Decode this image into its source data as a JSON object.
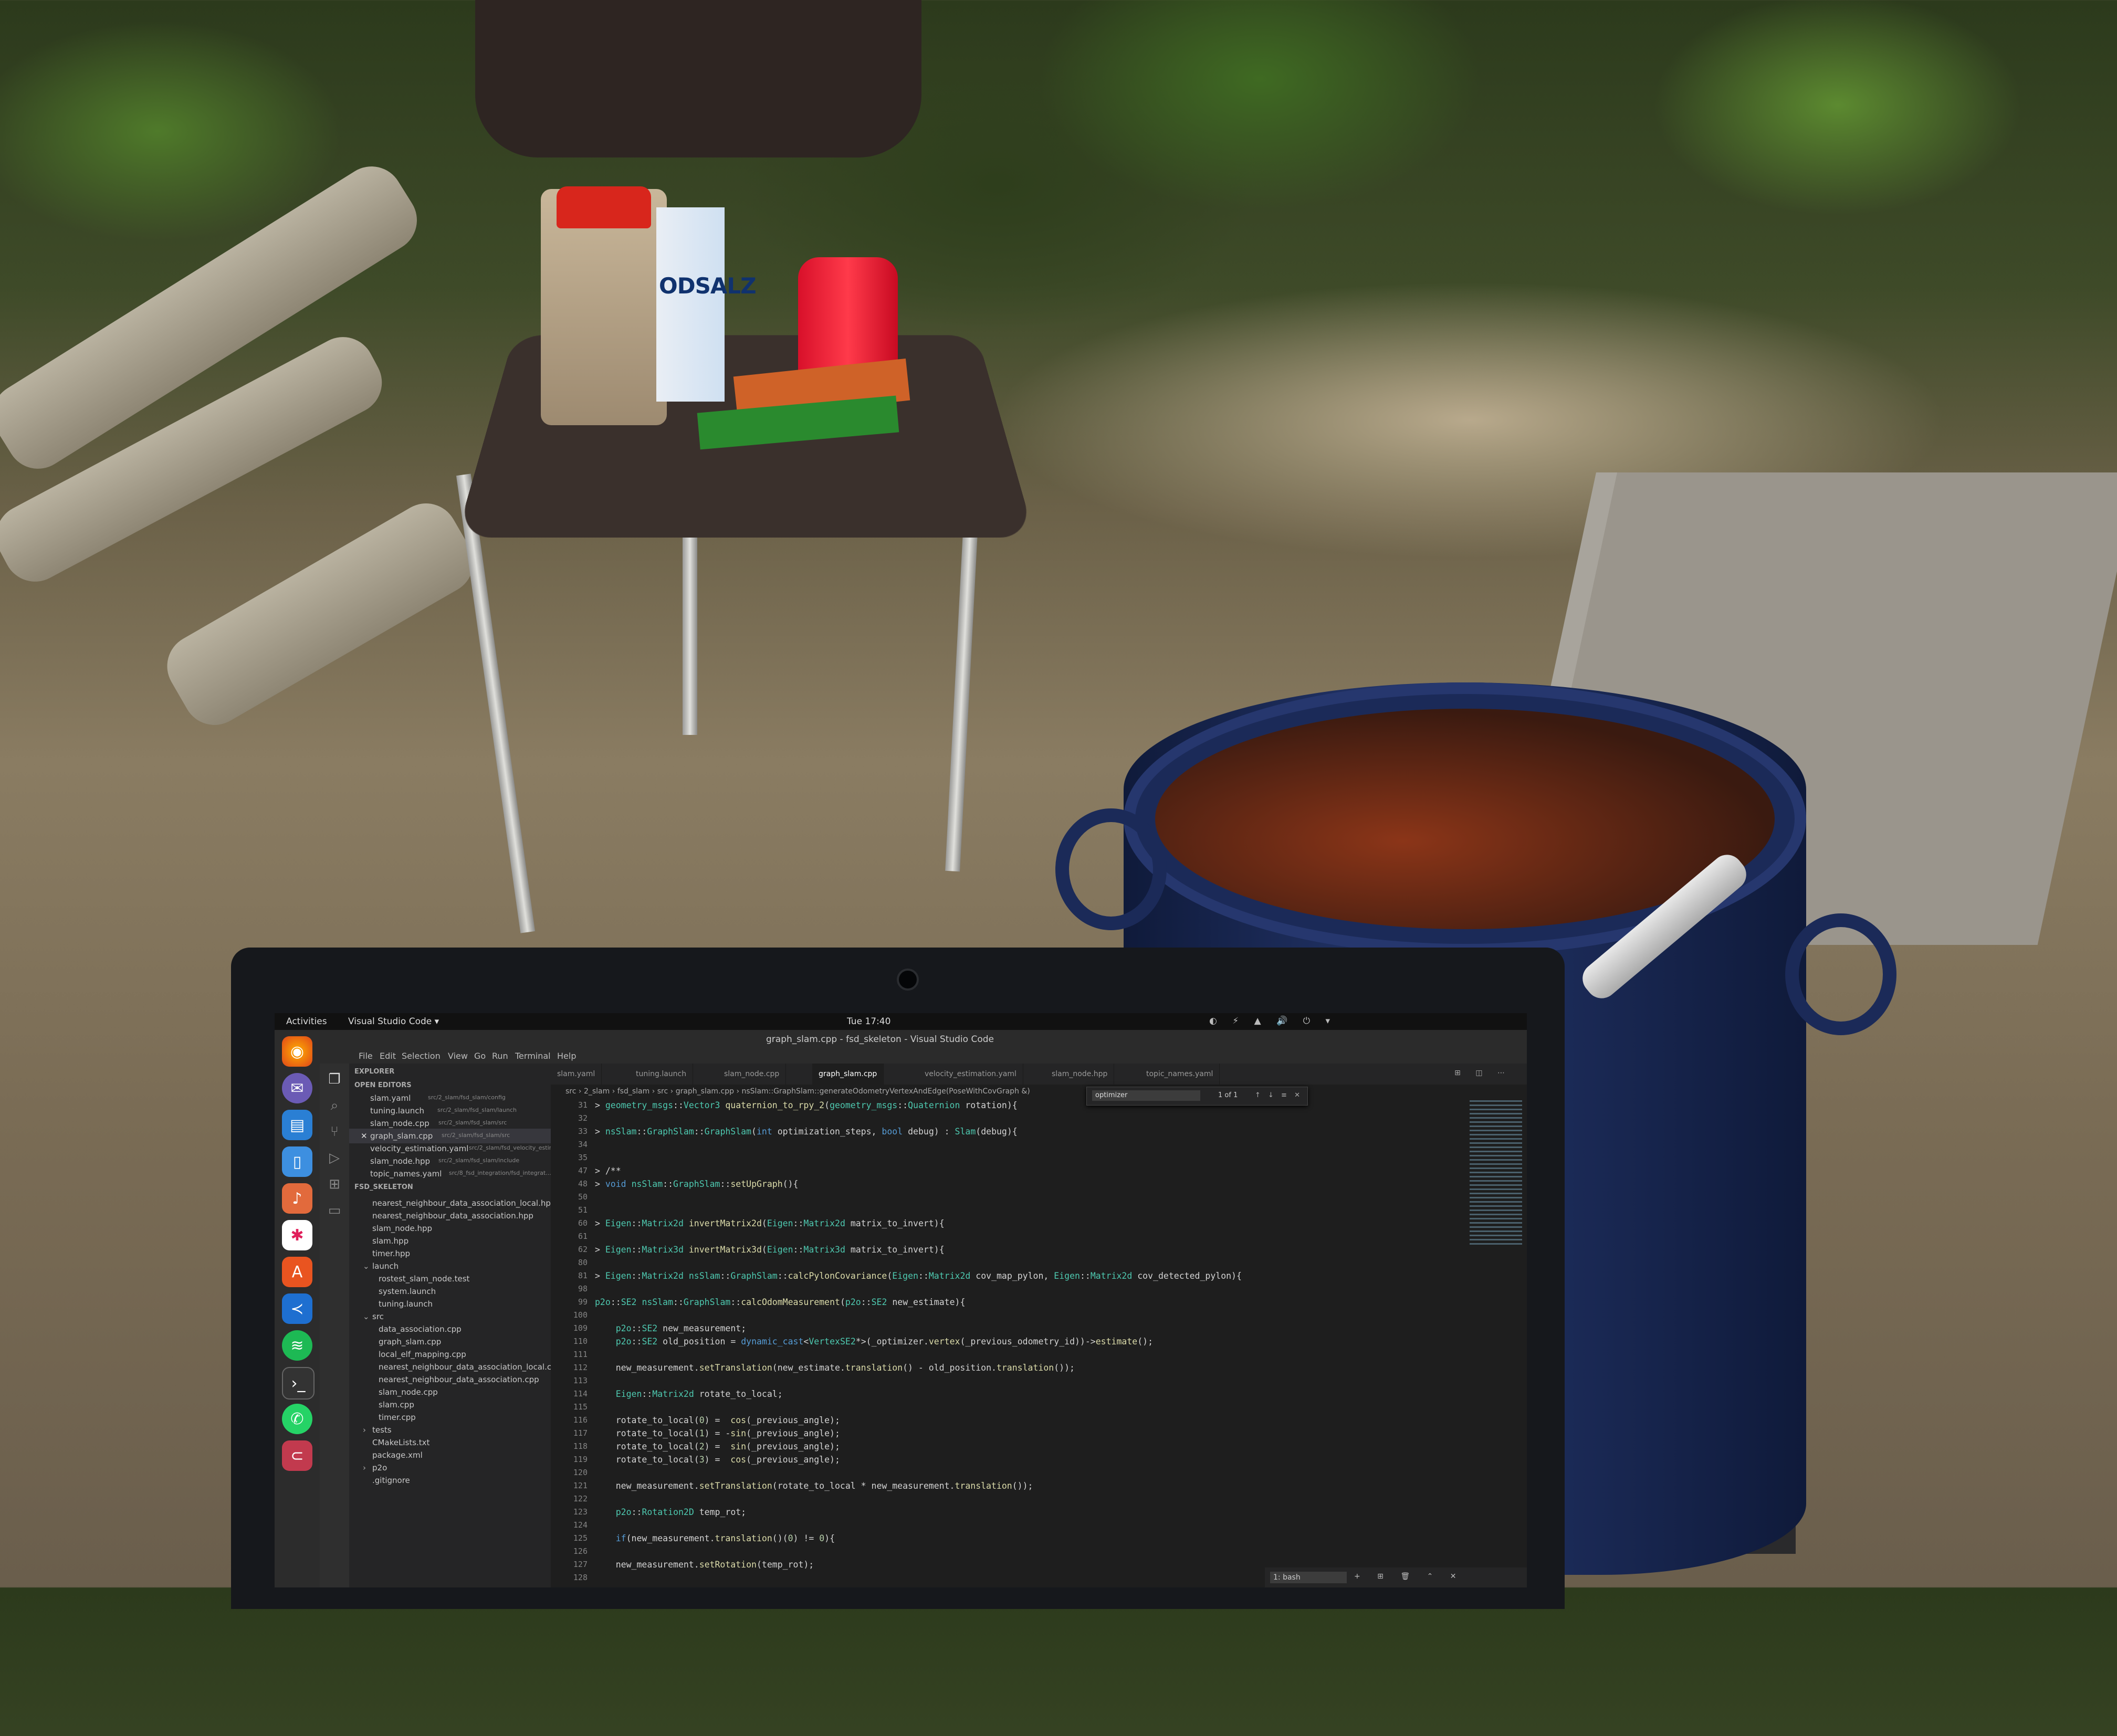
{
  "scene": {
    "salt_box_text": "ODSALZ"
  },
  "topbar": {
    "activities": "Activities",
    "app_menu": "Visual Studio Code ▾",
    "clock": "Tue 17:40",
    "tray_icons": "◐ ⚡ ▲ 🔊 ⏻ ▾"
  },
  "dock": {
    "icons": [
      "firefox-icon",
      "thunderbird-icon",
      "files-icon",
      "libreoffice-icon",
      "rhythmbox-icon",
      "slack-icon",
      "software-icon",
      "vscode-icon",
      "spotify-icon",
      "terminal-icon",
      "whatsapp-icon",
      "gitk-icon"
    ]
  },
  "vscode": {
    "window_title": "graph_slam.cpp - fsd_skeleton - Visual Studio Code",
    "menu": [
      "File",
      "Edit",
      "Selection",
      "View",
      "Go",
      "Run",
      "Terminal",
      "Help"
    ],
    "sidebar": {
      "explorer_label": "EXPLORER",
      "open_editors_label": "OPEN EDITORS",
      "open_editors": [
        {
          "name": "slam.yaml",
          "path": "src/2_slam/fsd_slam/config"
        },
        {
          "name": "tuning.launch",
          "path": "src/2_slam/fsd_slam/launch"
        },
        {
          "name": "slam_node.cpp",
          "path": "src/2_slam/fsd_slam/src"
        },
        {
          "name": "graph_slam.cpp",
          "path": "src/2_slam/fsd_slam/src"
        },
        {
          "name": "velocity_estimation.yaml",
          "path": "src/2_slam/fsd_velocity_estimati..."
        },
        {
          "name": "slam_node.hpp",
          "path": "src/2_slam/fsd_slam/include"
        },
        {
          "name": "topic_names.yaml",
          "path": "src/8_fsd_integration/fsd_integrat..."
        }
      ],
      "project_label": "FSD_SKELETON",
      "tree": [
        "nearest_neighbour_data_association_local.hpp",
        "nearest_neighbour_data_association.hpp",
        "slam_node.hpp",
        "slam.hpp",
        "timer.hpp",
        "launch",
        "rostest_slam_node.test",
        "system.launch",
        "tuning.launch",
        "src",
        "data_association.cpp",
        "graph_slam.cpp",
        "local_elf_mapping.cpp",
        "nearest_neighbour_data_association_local.cpp",
        "nearest_neighbour_data_association.cpp",
        "slam_node.cpp",
        "slam.cpp",
        "timer.cpp",
        "tests",
        "CMakeLists.txt",
        "package.xml",
        "p2o",
        ".gitignore"
      ]
    },
    "tabs": [
      "slam.yaml",
      "tuning.launch",
      "slam_node.cpp",
      "graph_slam.cpp",
      "velocity_estimation.yaml",
      "slam_node.hpp",
      "topic_names.yaml"
    ],
    "active_tab": "graph_slam.cpp",
    "breadcrumb": "src › 2_slam › fsd_slam › src › graph_slam.cpp › nsSlam::GraphSlam::generateOdometryVertexAndEdge(PoseWithCovGraph &)",
    "find": {
      "query": "optimizer",
      "count": "1 of 1",
      "options": "↑ ↓ ≡ ✕"
    },
    "line_numbers": [
      "31",
      "32",
      "33",
      "34",
      "35",
      "47",
      "48",
      "50",
      "51",
      "60",
      "61",
      "62",
      "80",
      "81",
      "98",
      "99",
      "100",
      "109",
      "110",
      "111",
      "112",
      "113",
      "114",
      "115",
      "116",
      "117",
      "118",
      "119",
      "120",
      "121",
      "122",
      "123",
      "124",
      "125",
      "126",
      "127",
      "128"
    ],
    "code": [
      "> geometry_msgs::Vector3 quaternion_to_rpy_2(geometry_msgs::Quaternion rotation){",
      "",
      "> nsSlam::GraphSlam::GraphSlam(int optimization_steps, bool debug) : Slam(debug){",
      "",
      "",
      "> /**",
      "> void nsSlam::GraphSlam::setUpGraph(){",
      "",
      "",
      "> Eigen::Matrix2d invertMatrix2d(Eigen::Matrix2d matrix_to_invert){",
      "",
      "> Eigen::Matrix3d invertMatrix3d(Eigen::Matrix3d matrix_to_invert){",
      "",
      "> Eigen::Matrix2d nsSlam::GraphSlam::calcPylonCovariance(Eigen::Matrix2d cov_map_pylon, Eigen::Matrix2d cov_detected_pylon){",
      "",
      "p2o::SE2 nsSlam::GraphSlam::calcOdomMeasurement(p2o::SE2 new_estimate){",
      "",
      "    p2o::SE2 new_measurement;",
      "    p2o::SE2 old_position = dynamic_cast<VertexSE2*>(_optimizer.vertex(_previous_odometry_id))->estimate();",
      "",
      "    new_measurement.setTranslation(new_estimate.translation() - old_position.translation());",
      "",
      "    Eigen::Matrix2d rotate_to_local;",
      "",
      "    rotate_to_local(0) =  cos(_previous_angle);",
      "    rotate_to_local(1) = -sin(_previous_angle);",
      "    rotate_to_local(2) =  sin(_previous_angle);",
      "    rotate_to_local(3) =  cos(_previous_angle);",
      "",
      "    new_measurement.setTranslation(rotate_to_local * new_measurement.translation());",
      "",
      "    p2o::Rotation2D temp_rot;",
      "",
      "    if(new_measurement.translation()(0) != 0){",
      "",
      "    new_measurement.setRotation(temp_rot);",
      ""
    ],
    "terminal": {
      "selected": "1: bash",
      "ops": "+ ⊞ 🗑 ⌃ ✕"
    }
  }
}
